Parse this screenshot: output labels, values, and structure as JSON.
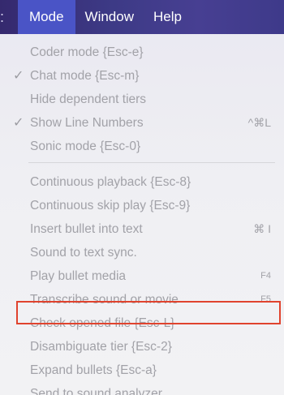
{
  "menubar": {
    "edge_glyph": ":",
    "menus": [
      "Mode",
      "Window",
      "Help"
    ]
  },
  "menu": {
    "group1": [
      {
        "label": "Coder mode {Esc-e}",
        "checked": false,
        "shortcut": ""
      },
      {
        "label": "Chat mode {Esc-m}",
        "checked": true,
        "shortcut": ""
      },
      {
        "label": "Hide dependent tiers",
        "checked": false,
        "shortcut": ""
      },
      {
        "label": "Show Line Numbers",
        "checked": true,
        "shortcut": "^⌘L"
      },
      {
        "label": "Sonic mode {Esc-0}",
        "checked": false,
        "shortcut": ""
      }
    ],
    "group2": [
      {
        "label": "Continuous playback {Esc-8}",
        "shortcut": ""
      },
      {
        "label": "Continuous skip play {Esc-9}",
        "shortcut": ""
      },
      {
        "label": "Insert bullet into text",
        "shortcut": "⌘ I"
      },
      {
        "label": "Sound to text sync.",
        "shortcut": ""
      },
      {
        "label": "Play bullet media",
        "shortcut": "F4"
      },
      {
        "label": "Transcribe sound or movie",
        "shortcut": "F5"
      },
      {
        "label": "Check opened file {Esc-L}",
        "shortcut": ""
      },
      {
        "label": "Disambiguate tier {Esc-2}",
        "shortcut": ""
      },
      {
        "label": "Expand bullets {Esc-a}",
        "shortcut": ""
      },
      {
        "label": "Send to sound analyzer",
        "shortcut": ""
      }
    ],
    "check_glyph": "✓"
  },
  "colors": {
    "menubar": "#3d3a86",
    "active_menu": "#4a54c6",
    "disabled_text": "#a2a2a8",
    "highlight_border": "#e0432e"
  }
}
